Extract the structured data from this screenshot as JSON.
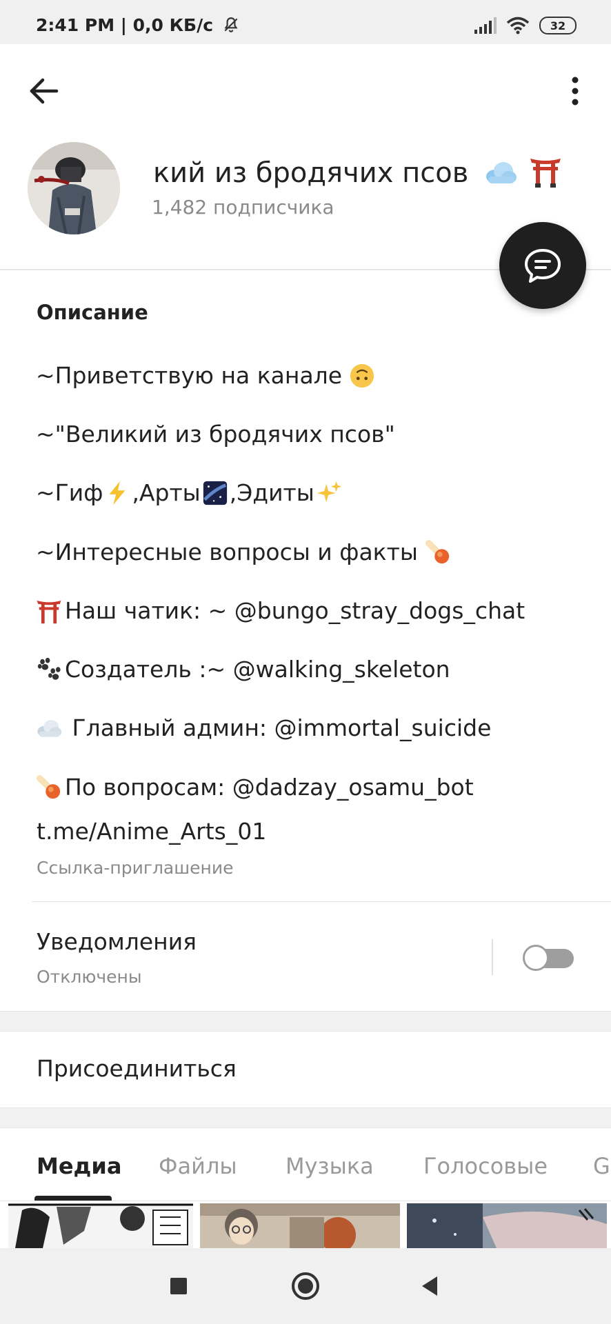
{
  "status_bar": {
    "time": "2:41 PM | 0,0 КБ/с",
    "battery": "32",
    "icons": [
      "bell-off-icon",
      "signal-icon",
      "wifi-icon",
      "battery-icon"
    ]
  },
  "header": {
    "back_icon": "arrow-left-icon",
    "more_icon": "more-vertical-icon",
    "channel_title": "кий из бродячих псов",
    "subscribers": "1,482 подписчика",
    "title_emojis": [
      "cloud",
      "torii-gate"
    ],
    "fab_icon": "chat-bubble-icon"
  },
  "description": {
    "title": "Описание",
    "lines": [
      {
        "prefix": "",
        "text": "~Приветствую на канале",
        "emoji_after": [
          "upside-down-face"
        ]
      },
      {
        "prefix": "",
        "text": "~\"Великий из бродячих псов\"",
        "emoji_after": []
      },
      {
        "prefix": "",
        "text": "~Гиф",
        "segments": [
          "~Гиф",
          ",Арты",
          ",Эдиты"
        ],
        "emoji_after": [
          "lightning",
          "night-sky",
          "sparkles"
        ]
      },
      {
        "prefix": "",
        "text": "~Интересные вопросы и факты",
        "emoji_after": [
          "comet"
        ]
      },
      {
        "prefix": "torii-gate",
        "text": "Наш чатик: ~ @bungo_stray_dogs_chat",
        "emoji_after": []
      },
      {
        "prefix": "paw-prints",
        "text": "Создатель :~ @walking_skeleton",
        "emoji_after": []
      },
      {
        "prefix": "cloud",
        "text": " Главный админ: @immortal_suicide",
        "emoji_after": []
      },
      {
        "prefix": "comet",
        "text": "По вопросам: @dadzay_osamu_bot",
        "emoji_after": []
      }
    ],
    "link": "t.me/Anime_Arts_01",
    "link_caption": "Ссылка-приглашение"
  },
  "notifications": {
    "label": "Уведомления",
    "state": "Отключены",
    "enabled": false
  },
  "join_label": "Присоединиться",
  "tabs": [
    {
      "label": "Медиа",
      "active": true
    },
    {
      "label": "Файлы",
      "active": false
    },
    {
      "label": "Музыка",
      "active": false
    },
    {
      "label": "Голосовые",
      "active": false
    },
    {
      "label": "GI",
      "active": false
    }
  ],
  "navbar": {
    "icons": [
      "square-recents-icon",
      "circle-home-icon",
      "triangle-back-icon"
    ]
  }
}
